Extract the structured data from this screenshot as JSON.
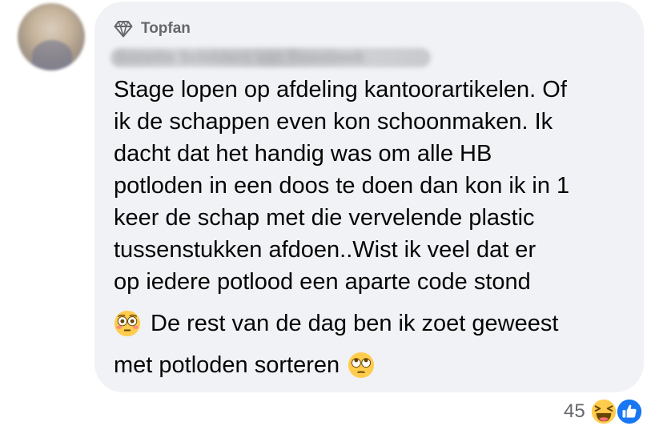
{
  "comment": {
    "badge": {
      "icon": "diamond-icon",
      "label": "Topfan"
    },
    "author_name_blurred": "Annette Schilders van Roosbeek",
    "text_lines": [
      "Stage lopen op afdeling kantoorartikelen. Of",
      "ik de schappen even kon schoonmaken. Ik",
      "dacht dat  het handig was om alle HB",
      "potloden in een doos te doen dan kon ik in 1",
      "keer de schap met die vervelende plastic",
      "tussenstukken  afdoen..Wist ik veel dat er",
      "op iedere potlood een aparte  code stond"
    ],
    "emoji_line_1": {
      "emoji": "flushed-face-emoji",
      "text": "De rest van de dag ben ik zoet geweest"
    },
    "emoji_line_2": {
      "text": "met potloden sorteren",
      "emoji": "face-with-rolling-eyes-emoji"
    }
  },
  "reactions": {
    "count": "45",
    "types": [
      "haha",
      "like"
    ]
  },
  "colors": {
    "bubble_bg": "#f0f2f5",
    "text": "#050505",
    "secondary_text": "#65676b",
    "like_blue": "#1877f2",
    "emoji_yellow": "#ffcc4d"
  }
}
